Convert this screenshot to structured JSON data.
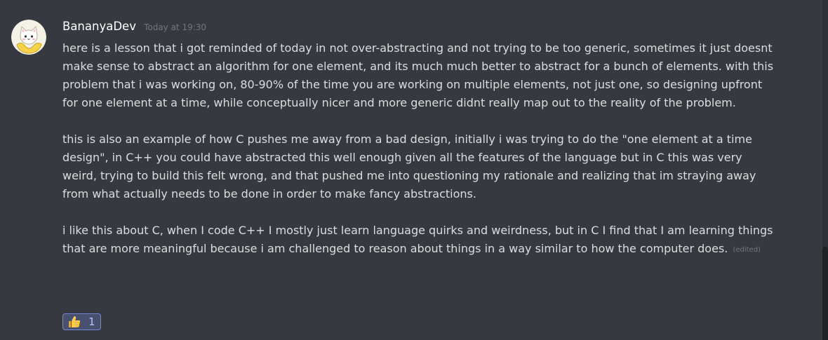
{
  "message": {
    "author": "BananyaDev",
    "timestamp": "Today at 19:30",
    "paragraphs": [
      "here is a lesson that i got reminded of today in not over-abstracting and not trying to be too generic, sometimes it just doesnt make sense to abstract an algorithm for one element, and its much much better to abstract for a bunch of elements. with this problem that i was working on, 80-90% of the time you are working on multiple elements, not just one, so designing upfront for one element at a time, while conceptually nicer and more generic didnt really map out to the reality of the problem.",
      "this is also an example of how C pushes me away from a bad design, initially i was trying to do the \"one element at a time design\", in C++ you could have abstracted this well enough given all the features of the language but in C this was very weird, trying to build this felt wrong, and that pushed me into questioning my rationale and realizing that im straying away from what actually needs to be done in order to make fancy abstractions.",
      "i like this about C, when I code C++ I mostly just learn language quirks and weirdness, but in C I find that I am learning things that are more meaningful because i am challenged to reason about things in a way similar to how the computer does."
    ],
    "edited_label": "(edited)",
    "reaction": {
      "emoji": "thumbs-up-icon",
      "count": "1"
    }
  },
  "colors": {
    "background": "#36393f",
    "username": "#ffffff",
    "text": "#dcddde",
    "muted": "#72767d",
    "reaction_border": "#7289da"
  }
}
